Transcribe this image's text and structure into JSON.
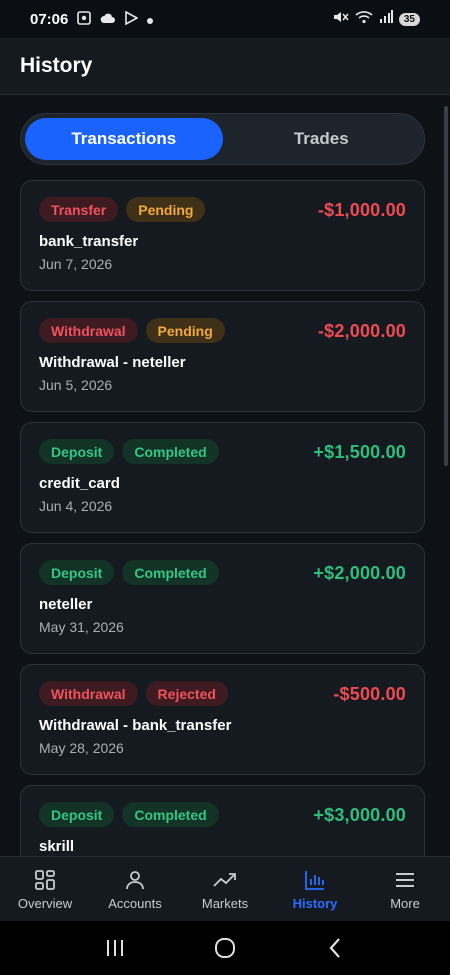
{
  "status_bar": {
    "time": "07:06",
    "battery": "35"
  },
  "header": {
    "title": "History"
  },
  "tabs": [
    {
      "label": "Transactions",
      "active": true
    },
    {
      "label": "Trades",
      "active": false
    }
  ],
  "transactions": [
    {
      "type": "Transfer",
      "status": "Pending",
      "amount": "-$1,000.00",
      "method": "bank_transfer",
      "date": "Jun 7, 2026"
    },
    {
      "type": "Withdrawal",
      "status": "Pending",
      "amount": "-$2,000.00",
      "method": "Withdrawal - neteller",
      "date": "Jun 5, 2026"
    },
    {
      "type": "Deposit",
      "status": "Completed",
      "amount": "+$1,500.00",
      "method": "credit_card",
      "date": "Jun 4, 2026"
    },
    {
      "type": "Deposit",
      "status": "Completed",
      "amount": "+$2,000.00",
      "method": "neteller",
      "date": "May 31, 2026"
    },
    {
      "type": "Withdrawal",
      "status": "Rejected",
      "amount": "-$500.00",
      "method": "Withdrawal - bank_transfer",
      "date": "May 28, 2026"
    },
    {
      "type": "Deposit",
      "status": "Completed",
      "amount": "+$3,000.00",
      "method": "skrill",
      "date": ""
    }
  ],
  "bottom_nav": [
    {
      "label": "Overview",
      "icon": "grid-icon",
      "active": false
    },
    {
      "label": "Accounts",
      "icon": "user-icon",
      "active": false
    },
    {
      "label": "Markets",
      "icon": "trending-up-icon",
      "active": false
    },
    {
      "label": "History",
      "icon": "bar-chart-icon",
      "active": true
    },
    {
      "label": "More",
      "icon": "menu-icon",
      "active": false
    }
  ],
  "colors": {
    "accent": "#1a63ff",
    "negative": "#ef4a52",
    "positive": "#2fbf7c",
    "pending": "#f2a93b"
  }
}
